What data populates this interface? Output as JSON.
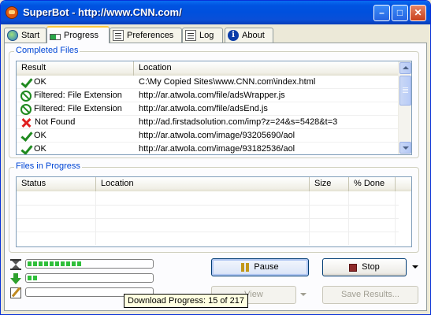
{
  "window": {
    "title": "SuperBot - http://www.CNN.com/"
  },
  "tabs": [
    {
      "label": "Start",
      "icon": "globe-icon"
    },
    {
      "label": "Progress",
      "icon": "progress-icon",
      "active": true
    },
    {
      "label": "Preferences",
      "icon": "preferences-icon"
    },
    {
      "label": "Log",
      "icon": "log-icon"
    },
    {
      "label": "About",
      "icon": "info-icon"
    }
  ],
  "completed": {
    "title": "Completed Files",
    "columns": [
      "Result",
      "Location"
    ],
    "rows": [
      {
        "status": "ok",
        "result": "OK",
        "location": "C:\\My Copied Sites\\www.CNN.com\\index.html"
      },
      {
        "status": "filtered",
        "result": "Filtered: File Extension",
        "location": "http://ar.atwola.com/file/adsWrapper.js"
      },
      {
        "status": "filtered",
        "result": "Filtered: File Extension",
        "location": "http://ar.atwola.com/file/adsEnd.js"
      },
      {
        "status": "error",
        "result": "Not Found",
        "location": "http://ad.firstadsolution.com/imp?z=24&s=5428&t=3"
      },
      {
        "status": "ok",
        "result": "OK",
        "location": "http://ar.atwola.com/image/93205690/aol"
      },
      {
        "status": "ok",
        "result": "OK",
        "location": "http://ar.atwola.com/image/93182536/aol"
      }
    ]
  },
  "in_progress": {
    "title": "Files in Progress",
    "columns": [
      "Status",
      "Location",
      "Size",
      "% Done"
    ]
  },
  "progress": {
    "download_fraction": 0.07,
    "second_fraction": 0.01,
    "third_fraction": 0.0
  },
  "buttons": {
    "pause": "Pause",
    "stop": "Stop",
    "view": "View",
    "save_results": "Save Results..."
  },
  "tooltip": "Download Progress: 15 of 217",
  "colors": {
    "accent": "#0046d5",
    "ok": "#1f8a1f",
    "error": "#e02020",
    "progress": "#2fbf3a"
  }
}
